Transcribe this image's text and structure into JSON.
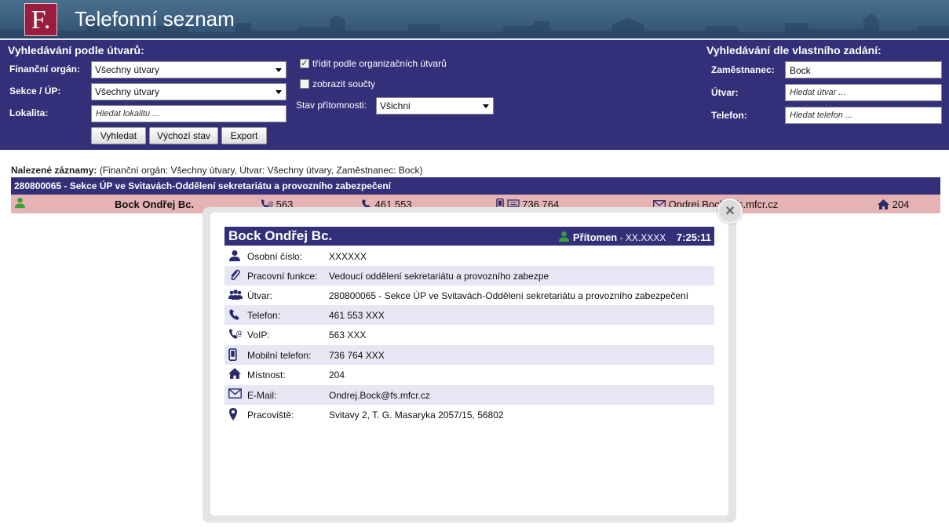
{
  "header": {
    "logo_text": "F.",
    "title": "Telefonní seznam"
  },
  "search_units": {
    "title": "Vyhledávání podle útvarů:",
    "financni_organ": {
      "label": "Finanční orgán:",
      "value": "Všechny útvary"
    },
    "sekce": {
      "label": "Sekce / ÚP:",
      "value": "Všechny útvary"
    },
    "lokalita": {
      "label": "Lokalita:",
      "placeholder": "Hledat lokalitu ..."
    },
    "buttons": {
      "search": "Vyhledat",
      "reset": "Výchozí stav",
      "export": "Export"
    },
    "sort_checkbox": {
      "label": "třídit podle organizačních útvarů",
      "checked": true
    },
    "totals_checkbox": {
      "label": "zobrazit součty",
      "checked": false
    },
    "presence": {
      "label": "Stav přítomnosti:",
      "value": "Všichni"
    }
  },
  "search_custom": {
    "title": "Vyhledávání dle vlastního zadání:",
    "employee": {
      "label": "Zaměstnanec:",
      "value": "Bock"
    },
    "unit": {
      "label": "Útvar:",
      "placeholder": "Hledat útvar ..."
    },
    "phone": {
      "label": "Telefon:",
      "placeholder": "Hledat telefon ..."
    }
  },
  "results": {
    "found_label": "Nalezené záznamy:",
    "found_filter": "(Finanční orgán: Všechny útvary, Útvar: Všechny útvary, Zaměstnanec: Bock)",
    "group": "280800065 - Sekce ÚP ve Svitavách-Oddělení sekretariátu a provozního zabezpečení",
    "row": {
      "name": "Bock Ondřej Bc.",
      "voip": "563",
      "phone": "461 553",
      "mobile": "736 764",
      "email": "Ondrej.Bock@fs.mfcr.cz",
      "room": "204"
    }
  },
  "detail": {
    "close_symbol": "×",
    "name": "Bock Ondřej Bc.",
    "status": "Přítomen",
    "status_suffix": " - XX.XXXX",
    "time": "7:25:11",
    "rows": [
      {
        "icon": "person-icon",
        "label": "Osobní číslo:",
        "value": "XXXXXX"
      },
      {
        "icon": "paperclip-icon",
        "label": "Pracovní funkce:",
        "value": "Vedoucí oddělení sekretariátu a provozního zabezpe"
      },
      {
        "icon": "group-icon",
        "label": "Útvar:",
        "value": "280800065 - Sekce ÚP ve Svitavách-Oddělení sekretariátu a provozního zabezpečení"
      },
      {
        "icon": "phone-icon",
        "label": "Telefon:",
        "value": "461 553 XXX"
      },
      {
        "icon": "voip-icon",
        "label": "VoIP:",
        "value": "563 XXX"
      },
      {
        "icon": "mobile-icon",
        "label": "Mobilní telefon:",
        "value": "736 764  XXX"
      },
      {
        "icon": "home-icon",
        "label": "Místnost:",
        "value": "204"
      },
      {
        "icon": "envelope-icon",
        "label": "E-Mail:",
        "value": "Ondrej.Bock@fs.mfcr.cz"
      },
      {
        "icon": "location-pin-icon",
        "label": "Pracoviště:",
        "value": "Svitavy 2, T. G. Masaryka 2057/15, 56802"
      }
    ]
  },
  "colors": {
    "navy": "#332f78",
    "row_highlight": "#e6b3b5",
    "alt_row": "#e6e6f4",
    "present_green": "#3aa03a",
    "logo": "#9a1d3f"
  }
}
